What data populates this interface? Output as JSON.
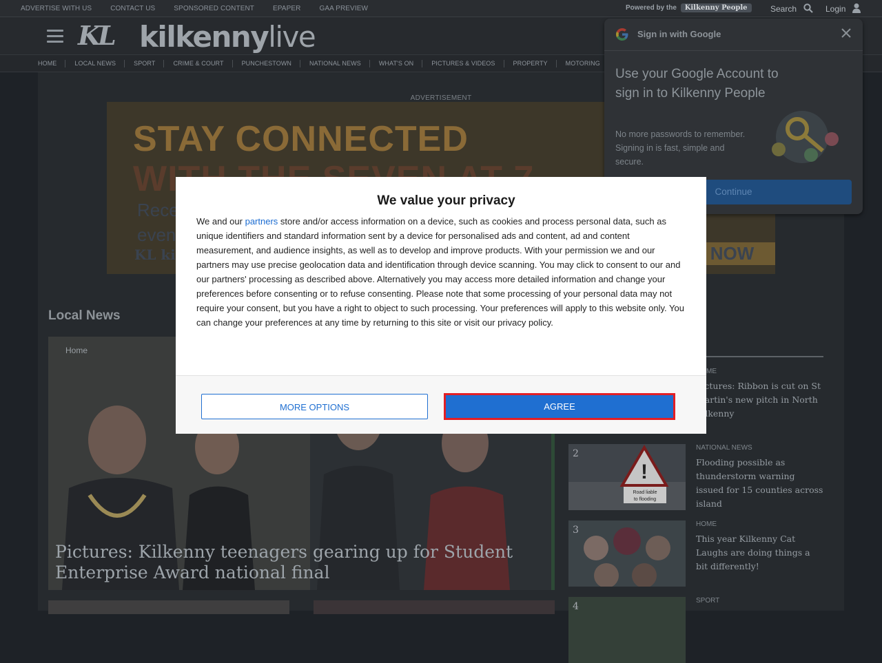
{
  "utility": {
    "links": [
      "ADVERTISE WITH US",
      "CONTACT US",
      "SPONSORED CONTENT",
      "EPAPER",
      "GAA PREVIEW"
    ],
    "powered_by": "Powered by the",
    "powered_brand": "Kilkenny People",
    "search_label": "Search",
    "login_label": "Login"
  },
  "header": {
    "logo_initials": "KL",
    "logo_word_bold": "kilkenny",
    "logo_word_light": "live"
  },
  "nav": {
    "items": [
      "HOME",
      "LOCAL NEWS",
      "SPORT",
      "CRIME & COURT",
      "PUNCHESTOWN",
      "NATIONAL NEWS",
      "WHAT'S ON",
      "PICTURES & VIDEOS",
      "PROPERTY",
      "MOTORING"
    ]
  },
  "ad": {
    "label": "ADVERTISEMENT",
    "line1": "STAY CONNECTED",
    "line2": "WITH THE SEVEN AT 7",
    "line3": "Rece",
    "line4": "even",
    "logo": "KL kilk",
    "cta": "NOW"
  },
  "main": {
    "section_title": "Local News",
    "hero": {
      "category": "Home",
      "title": "Pictures: Kilkenny teenagers gearing up for Student Enterprise Award national final"
    }
  },
  "sidebar": {
    "items": [
      {
        "num": "",
        "category": "HOME",
        "title": "Pictures: Ribbon is cut on St Martin's new pitch in North Kilkenny"
      },
      {
        "num": "2",
        "category": "NATIONAL NEWS",
        "title": "Flooding possible as thunderstorm warning issued for 15 counties across island"
      },
      {
        "num": "3",
        "category": "HOME",
        "title": "This year Kilkenny Cat Laughs are doing things a bit differently!"
      },
      {
        "num": "4",
        "category": "SPORT",
        "title": ""
      }
    ]
  },
  "google_signin": {
    "header": "Sign in with Google",
    "title": "Use your Google Account to sign in to Kilkenny People",
    "body": "No more passwords to remember. Signing in is fast, simple and secure.",
    "continue_label": "Continue"
  },
  "consent": {
    "title": "We value your privacy",
    "text_before_link": "We and our ",
    "link_text": "partners",
    "text_after_link": " store and/or access information on a device, such as cookies and process personal data, such as unique identifiers and standard information sent by a device for personalised ads and content, ad and content measurement, and audience insights, as well as to develop and improve products. With your permission we and our partners may use precise geolocation data and identification through device scanning. You may click to consent to our and our partners' processing as described above. Alternatively you may access more detailed information and change your preferences before consenting or to refuse consenting. Please note that some processing of your personal data may not require your consent, but you have a right to object to such processing. Your preferences will apply to this website only. You can change your preferences at any time by returning to this site or visit our privacy policy.",
    "more_options_label": "MORE OPTIONS",
    "agree_label": "AGREE"
  },
  "colors": {
    "accent_blue": "#1f6fd1",
    "highlight_red": "#e31f25",
    "dim_background": "#1e2227"
  }
}
